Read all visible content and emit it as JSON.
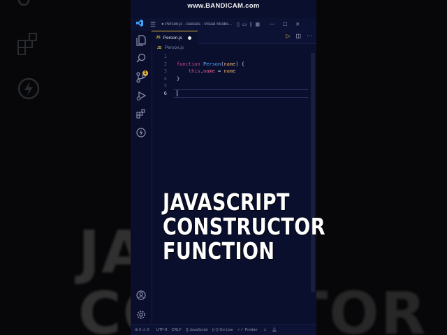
{
  "watermark": "www.BANDICAM.com",
  "window": {
    "title": "● Person.js - classes - Visual Studio...",
    "minimize": "—",
    "maximize": "☐",
    "close": "✕"
  },
  "activity_bar": {
    "icons": [
      "files-icon",
      "search-icon",
      "source-control-icon",
      "run-debug-icon",
      "extensions-icon",
      "lightning-icon",
      "account-icon",
      "gear-icon"
    ],
    "explorer_badge": "1"
  },
  "tab": {
    "file_icon": "JS",
    "name": "Person.js"
  },
  "breadcrumb": {
    "file_icon": "JS",
    "name": "Person.js"
  },
  "editor": {
    "line_numbers": [
      "1",
      "2",
      "3",
      "4",
      "5",
      "6"
    ],
    "lines": [
      {
        "tokens": []
      },
      {
        "tokens": [
          {
            "t": "function",
            "c": "kw"
          },
          {
            "t": " ",
            "c": ""
          },
          {
            "t": "Person",
            "c": "fn"
          },
          {
            "t": "(",
            "c": ""
          },
          {
            "t": "name",
            "c": "param"
          },
          {
            "t": ") {",
            "c": ""
          }
        ]
      },
      {
        "tokens": [
          {
            "t": "    ",
            "c": ""
          },
          {
            "t": "this",
            "c": "this"
          },
          {
            "t": ".",
            "c": ""
          },
          {
            "t": "name",
            "c": "prop"
          },
          {
            "t": " = ",
            "c": ""
          },
          {
            "t": "name",
            "c": "param"
          }
        ]
      },
      {
        "tokens": [
          {
            "t": "}",
            "c": ""
          }
        ]
      },
      {
        "tokens": []
      },
      {
        "tokens": []
      }
    ],
    "active_line": "6"
  },
  "status_bar": {
    "problems": "⊗ 0 ⚠ 0",
    "encoding": "UTF-8",
    "eol": "CRLF",
    "language": "{} JavaScript",
    "go_live": "((·)) Go Live",
    "prettier": "✓✓ Prettier"
  },
  "headline": {
    "line1": "JAVASCRIPT",
    "line2": "CONSTRUCTOR",
    "line3": "FUNCTION"
  },
  "background_text": {
    "line1": "JA",
    "line2": "CO",
    "right1": "TOR"
  },
  "colors": {
    "editor_bg": "#0a0f2e",
    "keyword": "#d14a8f",
    "function": "#59a7ff",
    "param": "#e4a96b",
    "accent": "#e3b53b"
  }
}
